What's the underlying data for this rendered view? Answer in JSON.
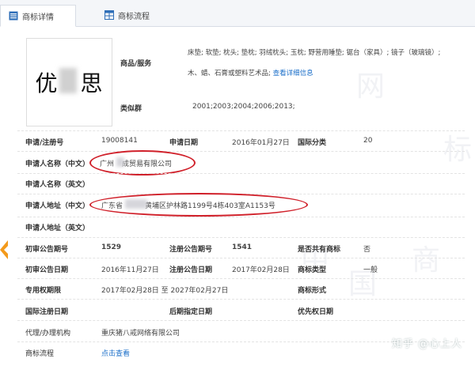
{
  "tabs": [
    {
      "label": "商标详情",
      "icon": "document-list-icon",
      "active": true
    },
    {
      "label": "商标流程",
      "icon": "grid-table-icon",
      "active": false
    }
  ],
  "trademark": {
    "logo_text": "优",
    "logo_text2": "思"
  },
  "goods": {
    "label": "商品/服务",
    "line1": "床垫; 软垫; 枕头; 垫枕; 羽绒枕头; 玉枕; 野营用睡垫; 锯台（家具）; 镜子（玻璃镜）;",
    "line2": "木、蜡、石膏或塑料艺术品;",
    "details_link": "查看详细信息"
  },
  "similar_group": {
    "label": "类似群",
    "value": "2001;2003;2004;2006;2013;"
  },
  "rows": {
    "reg_no_label": "申请/注册号",
    "reg_no": "19008141",
    "apply_date_label": "申请日期",
    "apply_date": "2016年01月27日",
    "intl_class_label": "国际分类",
    "intl_class": "20",
    "applicant_cn_label": "申请人名称（中文）",
    "applicant_cn_a": "广州",
    "applicant_cn_b": "成贸易有限公司",
    "applicant_en_label": "申请人名称（英文）",
    "address_cn_label": "申请人地址（中文）",
    "address_cn_a": "广东省",
    "address_cn_b": "黄埔区护林路1199号4栋403室A1153号",
    "address_en_label": "申请人地址（英文）",
    "prelim_no_label": "初审公告期号",
    "prelim_no": "1529",
    "reg_pub_no_label": "注册公告期号",
    "reg_pub_no": "1541",
    "shared_label": "是否共有商标",
    "shared": "否",
    "prelim_date_label": "初审公告日期",
    "prelim_date": "2016年11月27日",
    "reg_pub_date_label": "注册公告日期",
    "reg_pub_date": "2017年02月28日",
    "tm_type_label": "商标类型",
    "tm_type": "一般",
    "exclusive_label": "专用权期限",
    "exclusive": "2017年02月28日 至 2027年02月27日",
    "tm_form_label": "商标形式",
    "intl_reg_date_label": "国际注册日期",
    "later_date_label": "后期指定日期",
    "priority_date_label": "优先权日期",
    "agent_label": "代理/办理机构",
    "agent": "重庆猪八戒网络有限公司",
    "flow_label": "商标流程",
    "flow_link": "点击查看"
  },
  "watermark": {
    "text": "知乎 @心上人"
  },
  "colors": {
    "accent": "#1b6fc9",
    "annotation": "#d0202a"
  }
}
